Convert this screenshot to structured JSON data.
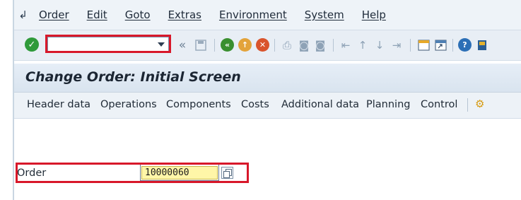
{
  "menu": {
    "items": [
      {
        "label": "Order",
        "key": "O"
      },
      {
        "label": "Edit",
        "key": "E"
      },
      {
        "label": "Goto",
        "key": "G"
      },
      {
        "label": "Extras",
        "key": "x"
      },
      {
        "label": "Environment",
        "key": "v"
      },
      {
        "label": "System",
        "key": "y"
      },
      {
        "label": "Help",
        "key": "H"
      }
    ]
  },
  "toolbar": {
    "command_field": {
      "value": "",
      "placeholder": ""
    },
    "double_arrow": "«",
    "icons": [
      "save-icon",
      "back-icon",
      "exit-icon",
      "cancel-icon",
      "print-icon",
      "find-icon",
      "find-next-icon",
      "first-page-icon",
      "previous-page-icon",
      "next-page-icon",
      "last-page-icon",
      "create-session-icon",
      "shortcut-icon",
      "help-icon",
      "customize-layout-icon"
    ]
  },
  "screen": {
    "title": "Change Order: Initial Screen"
  },
  "app_toolbar": {
    "buttons": [
      "Header data",
      "Operations",
      "Components",
      "Costs",
      "Additional data",
      "Planning",
      "Control"
    ]
  },
  "form": {
    "order_label": "Order",
    "order_value": "10000060"
  },
  "colors": {
    "highlight": "#d8182a",
    "input_yellow": "#fff6a8",
    "ok_green": "#2f9a3a",
    "back_green": "#3a8f2f",
    "exit_orange": "#e3a33a",
    "cancel_red": "#d9542c"
  }
}
